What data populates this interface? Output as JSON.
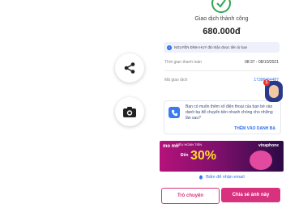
{
  "receipt": {
    "title": "Giao dịch thành công",
    "amount": "680.000đ",
    "notice": "NGUYỄN ĐÌNH HUY đã nhận được tiền từ bạn",
    "time_label": "Thời gian thanh toán",
    "time_value": "08:37 - 08/10/2021",
    "code_label": "Mã giao dịch",
    "code_value": "17396154487"
  },
  "contact": {
    "text": "Bạn có muốn thêm số điện thoại của bạn bè vào danh bạ để chuyển tiền nhanh chóng cho những lần sau?",
    "link": "THÊM VÀO DANH BẠ"
  },
  "banner": {
    "logo": "mo mo",
    "headline": "SIÊU HOÀN TIỀN",
    "percent": "30%",
    "percent_prefix": "Đến",
    "brand": "vinaphone"
  },
  "email_link": "Bấm để nhận email",
  "buttons": {
    "chat": "Trò chuyện",
    "share_photo": "Chia sẻ ảnh này"
  },
  "chat_badge": "1",
  "colors": {
    "accent": "#d8317d",
    "link": "#2b6ff0",
    "success": "#2fa84f"
  }
}
